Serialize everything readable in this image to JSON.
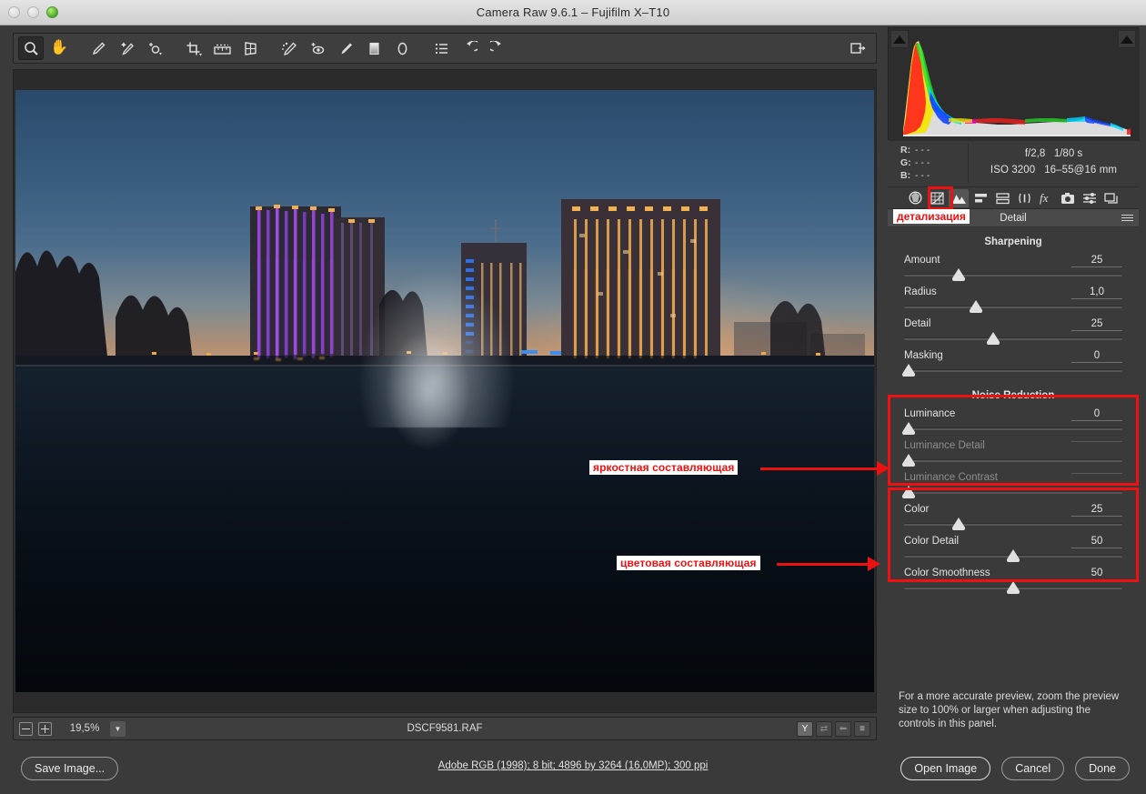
{
  "window": {
    "title": "Camera Raw 9.6.1  –  Fujifilm X–T10"
  },
  "toolbar": {
    "tools": [
      {
        "name": "zoom-tool",
        "active": true
      },
      {
        "name": "hand-tool",
        "active": false
      },
      {
        "name": "white-balance-tool",
        "active": false
      },
      {
        "name": "color-sampler-tool",
        "active": false
      },
      {
        "name": "targeted-adjustment-tool",
        "active": false
      },
      {
        "name": "crop-tool",
        "active": false
      },
      {
        "name": "straighten-tool",
        "active": false
      },
      {
        "name": "transform-tool",
        "active": false
      },
      {
        "name": "spot-removal-tool",
        "active": false
      },
      {
        "name": "red-eye-removal-tool",
        "active": false
      },
      {
        "name": "adjustment-brush-tool",
        "active": false
      },
      {
        "name": "graduated-filter-tool",
        "active": false
      },
      {
        "name": "radial-filter-tool",
        "active": false
      },
      {
        "name": "preferences-tool",
        "active": false
      },
      {
        "name": "rotate-left-tool",
        "active": false
      },
      {
        "name": "rotate-right-tool",
        "active": false
      }
    ],
    "filmstrip_toggle": "open-in-filmstrip"
  },
  "histogram": {
    "shadow_clipping_label": "shadow-clipping-warning",
    "highlight_clipping_label": "highlight-clipping-warning"
  },
  "readout": {
    "r_label": "R:",
    "r_value": "- - -",
    "g_label": "G:",
    "g_value": "- - -",
    "b_label": "B:",
    "b_value": "- - -",
    "aperture": "f/2,8",
    "shutter": "1/80 s",
    "iso": "ISO 3200",
    "lens": "16–55@16 mm"
  },
  "panel_tabs": [
    {
      "name": "tab-basic",
      "icon": "aperture-icon",
      "active": false
    },
    {
      "name": "tab-tone-curve",
      "icon": "curve-grid-icon",
      "active": false
    },
    {
      "name": "tab-detail",
      "icon": "triangles-icon",
      "active": true
    },
    {
      "name": "tab-hsl-grayscale",
      "icon": "sliders-stack-icon",
      "active": false
    },
    {
      "name": "tab-split-toning",
      "icon": "split-bars-icon",
      "active": false
    },
    {
      "name": "tab-lens-corrections",
      "icon": "lens-icon",
      "active": false
    },
    {
      "name": "tab-effects",
      "icon": "fx-icon",
      "active": false
    },
    {
      "name": "tab-camera-calibration",
      "icon": "camera-icon",
      "active": false
    },
    {
      "name": "tab-presets",
      "icon": "equalizer-icon",
      "active": false
    },
    {
      "name": "tab-snapshots",
      "icon": "layers-icon",
      "active": false
    }
  ],
  "panel": {
    "title": "Detail",
    "sharpening_title": "Sharpening",
    "noise_reduction_title": "Noise Reduction",
    "sharpening": [
      {
        "label": "Amount",
        "value": "25",
        "pos": 25,
        "disabled": false
      },
      {
        "label": "Radius",
        "value": "1,0",
        "pos": 33,
        "disabled": false
      },
      {
        "label": "Detail",
        "value": "25",
        "pos": 41,
        "disabled": false
      },
      {
        "label": "Masking",
        "value": "0",
        "pos": 2,
        "disabled": false
      }
    ],
    "noise_reduction": [
      {
        "label": "Luminance",
        "value": "0",
        "pos": 2,
        "disabled": false
      },
      {
        "label": "Luminance Detail",
        "value": "",
        "pos": 2,
        "disabled": true
      },
      {
        "label": "Luminance Contrast",
        "value": "",
        "pos": 2,
        "disabled": true
      },
      {
        "label": "Color",
        "value": "25",
        "pos": 25,
        "disabled": false
      },
      {
        "label": "Color Detail",
        "value": "50",
        "pos": 50,
        "disabled": false
      },
      {
        "label": "Color Smoothness",
        "value": "50",
        "pos": 50,
        "disabled": false
      }
    ],
    "hint": "For a more accurate preview, zoom the preview size to 100% or larger when adjusting the controls in this panel."
  },
  "preview_bar": {
    "zoom_out": "−",
    "zoom_in": "+",
    "zoom_level": "19,5%",
    "filename": "DSCF9581.RAF",
    "buttons": [
      {
        "name": "preview-toggle",
        "label": "Y"
      },
      {
        "name": "compare-before-after",
        "label": "⇄"
      },
      {
        "name": "swap-before-after",
        "label": "⬅"
      },
      {
        "name": "preview-preferences",
        "label": "≡"
      }
    ]
  },
  "bottom_bar": {
    "save_image": "Save Image...",
    "workflow_options": "Adobe RGB (1998); 8 bit; 4896 by 3264 (16,0MP); 300 ppi",
    "open_image": "Open Image",
    "cancel": "Cancel",
    "done": "Done"
  },
  "annotations": {
    "detail_tab": "детализация",
    "luminance": "яркостная составляющая",
    "color": "цветовая составляющая",
    "highlight_color": "#ee1111"
  },
  "colors": {
    "panel_bg": "#3a3a3a",
    "canvas_bg": "#2b2b2b",
    "titlebar": "#d8d8d8",
    "text": "#e3e3e3",
    "accent_red": "#ee1111"
  }
}
